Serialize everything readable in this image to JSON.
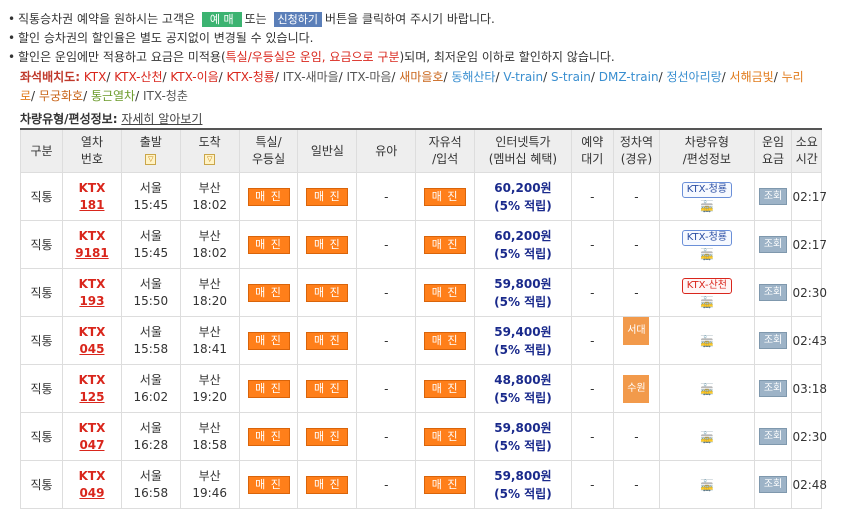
{
  "notices": {
    "line1_before": "직통승차권 예약을 원하시는 고객은",
    "line1_btn_book": "예 매",
    "line1_mid": "또는",
    "line1_btn_apply": "신청하기",
    "line1_after": "버튼을 클릭하여 주시기 바랍니다.",
    "line2": "할인 승차권의 할인율은 별도 공지없이 변경될 수 있습니다.",
    "line3_before": "할인은 운임에만 적용하고 요금은 미적용(",
    "line3_red": "특실/우등실은 운임, 요금으로 구분",
    "line3_after": ")되며, 최저운임 이하로 할인하지 않습니다."
  },
  "seats": {
    "lead": "좌석배치도:",
    "links": [
      {
        "label": "KTX",
        "color": "#d9261c"
      },
      {
        "label": "KTX-산천",
        "color": "#d9261c"
      },
      {
        "label": "KTX-이음",
        "color": "#d9261c"
      },
      {
        "label": "KTX-청룡",
        "color": "#d9261c"
      },
      {
        "label": "ITX-새마을",
        "color": "#555555"
      },
      {
        "label": "ITX-마음",
        "color": "#555555"
      },
      {
        "label": "새마을호",
        "color": "#c9651a"
      },
      {
        "label": "동해산타",
        "color": "#3a8fd0"
      },
      {
        "label": "V-train",
        "color": "#3a8fd0"
      },
      {
        "label": "S-train",
        "color": "#3a8fd0"
      },
      {
        "label": "DMZ-train",
        "color": "#3a8fd0"
      },
      {
        "label": "정선아리랑",
        "color": "#3a8fd0"
      },
      {
        "label": "서해금빛",
        "color": "#e07a1a"
      },
      {
        "label": "누리로",
        "color": "#e07a1a"
      },
      {
        "label": "무궁화호",
        "color": "#c9651a"
      },
      {
        "label": "통근열차",
        "color": "#6b9a2a"
      },
      {
        "label": "ITX-청춘",
        "color": "#555555"
      }
    ]
  },
  "info": {
    "lead": "차량유형/편성정보:",
    "link": "자세히 알아보기"
  },
  "headers": {
    "type": "구분",
    "train_no_1": "열차",
    "train_no_2": "번호",
    "dep": "출발",
    "arr": "도착",
    "first_1": "특실/",
    "first_2": "우등실",
    "general": "일반실",
    "infant": "유아",
    "free_1": "자유석",
    "free_2": "/입석",
    "price_1": "인터넷특가",
    "price_2": "(멤버십 혜택)",
    "wait_1": "예약",
    "wait_2": "대기",
    "stop_1": "정차역",
    "stop_2": "(경유)",
    "cartype_1": "차량유형",
    "cartype_2": "/편성정보",
    "fare_1": "운임",
    "fare_2": "요금",
    "dur_1": "소요",
    "dur_2": "시간",
    "sort_icon": "▽"
  },
  "rows": [
    {
      "type": "직통",
      "train": "KTX",
      "no": "181",
      "dep": "서울",
      "dep_time": "15:45",
      "arr": "부산",
      "arr_time": "18:02",
      "first": "매 진",
      "general": "매 진",
      "infant": "-",
      "free": "매 진",
      "price": "60,200원",
      "reward": "(5% 적립)",
      "wait": "-",
      "stop": "-",
      "badge": "KTX-청룡",
      "badge_red": false,
      "car": "🚋",
      "fare": "조회",
      "dur": "02:17"
    },
    {
      "type": "직통",
      "train": "KTX",
      "no": "9181",
      "dep": "서울",
      "dep_time": "15:45",
      "arr": "부산",
      "arr_time": "18:02",
      "first": "매 진",
      "general": "매 진",
      "infant": "-",
      "free": "매 진",
      "price": "60,200원",
      "reward": "(5% 적립)",
      "wait": "-",
      "stop": "-",
      "badge": "KTX-청룡",
      "badge_red": false,
      "car": "🚋",
      "fare": "조회",
      "dur": "02:17"
    },
    {
      "type": "직통",
      "train": "KTX",
      "no": "193",
      "dep": "서울",
      "dep_time": "15:50",
      "arr": "부산",
      "arr_time": "18:20",
      "first": "매 진",
      "general": "매 진",
      "infant": "-",
      "free": "매 진",
      "price": "59,800원",
      "reward": "(5% 적립)",
      "wait": "-",
      "stop": "-",
      "badge": "KTX-산천",
      "badge_red": true,
      "car": "🚋",
      "fare": "조회",
      "dur": "02:30"
    },
    {
      "type": "직통",
      "train": "KTX",
      "no": "045",
      "dep": "서울",
      "dep_time": "15:58",
      "arr": "부산",
      "arr_time": "18:41",
      "first": "매 진",
      "general": "매 진",
      "infant": "-",
      "free": "매 진",
      "price": "59,400원",
      "reward": "(5% 적립)",
      "wait": "-",
      "stop": "서대구",
      "badge": "",
      "badge_red": false,
      "car": "🚋",
      "fare": "조회",
      "dur": "02:43"
    },
    {
      "type": "직통",
      "train": "KTX",
      "no": "125",
      "dep": "서울",
      "dep_time": "16:02",
      "arr": "부산",
      "arr_time": "19:20",
      "first": "매 진",
      "general": "매 진",
      "infant": "-",
      "free": "매 진",
      "price": "48,800원",
      "reward": "(5% 적립)",
      "wait": "-",
      "stop": "수원",
      "badge": "",
      "badge_red": false,
      "car": "🚋",
      "fare": "조회",
      "dur": "03:18"
    },
    {
      "type": "직통",
      "train": "KTX",
      "no": "047",
      "dep": "서울",
      "dep_time": "16:28",
      "arr": "부산",
      "arr_time": "18:58",
      "first": "매 진",
      "general": "매 진",
      "infant": "-",
      "free": "매 진",
      "price": "59,800원",
      "reward": "(5% 적립)",
      "wait": "-",
      "stop": "-",
      "badge": "",
      "badge_red": false,
      "car": "🚋",
      "fare": "조회",
      "dur": "02:30"
    },
    {
      "type": "직통",
      "train": "KTX",
      "no": "049",
      "dep": "서울",
      "dep_time": "16:58",
      "arr": "부산",
      "arr_time": "19:46",
      "first": "매 진",
      "general": "매 진",
      "infant": "-",
      "free": "매 진",
      "price": "59,800원",
      "reward": "(5% 적립)",
      "wait": "-",
      "stop": "-",
      "badge": "",
      "badge_red": false,
      "car": "🚋",
      "fare": "조회",
      "dur": "02:48"
    }
  ]
}
